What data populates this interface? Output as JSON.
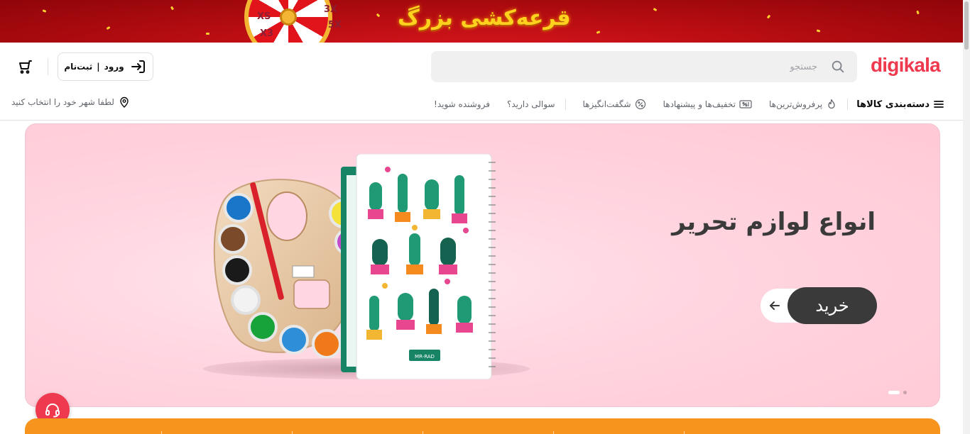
{
  "promo": {
    "title": "قرعه‌کشی بزرگ",
    "wheel_labels": [
      "XS",
      "3X",
      "5X",
      "X3"
    ]
  },
  "header": {
    "logo": "digikala",
    "search": {
      "placeholder": "جستجو"
    },
    "login": {
      "label_login": "ورود",
      "separator": "|",
      "label_register": "ثبت‌نام"
    }
  },
  "nav": {
    "categories": "دسته‌بندی کالاها",
    "items": [
      {
        "label": "پرفروش‌ترین‌ها",
        "icon": "fire-icon"
      },
      {
        "label": "تخفیف‌ها و پیشنهادها",
        "icon": "discount-ticket-icon"
      },
      {
        "label": "شگفت‌انگیزها",
        "icon": "percent-badge-icon"
      },
      {
        "label": "سوالی دارید؟",
        "icon": ""
      },
      {
        "label": "فروشنده شوید!",
        "icon": ""
      }
    ],
    "location": "لطفا شهر خود را انتخاب کنید"
  },
  "hero": {
    "title": "انواع لوازم تحریر",
    "button": "خرید",
    "notebook_brand": "MR-RAD",
    "slide_count": 2,
    "active_slide": 1
  },
  "colors": {
    "brand": "#ef394e",
    "hero_bg": "#ffc9d5",
    "button_dark": "#3a3a3a",
    "strip": "#f7941d"
  }
}
